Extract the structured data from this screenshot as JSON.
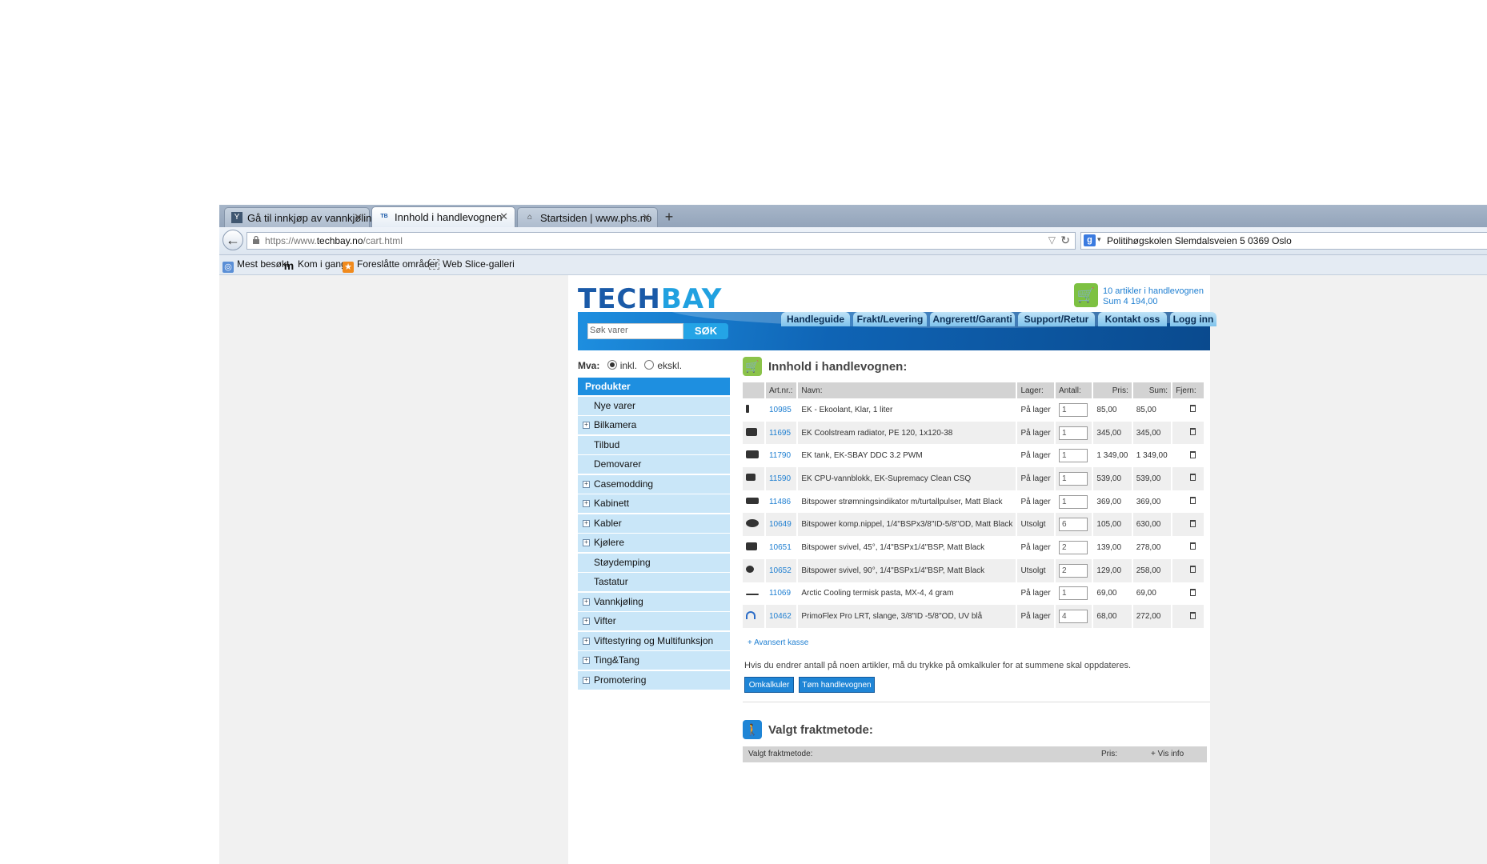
{
  "browser": {
    "tabs": [
      {
        "label": "Gå til innkjøp av vannkjølin...",
        "icon": "y-favicon",
        "active": false
      },
      {
        "label": "Innhold i handlevognen",
        "icon": "techbay-favicon",
        "active": true
      },
      {
        "label": "Startsiden | www.phs.no",
        "icon": "phs-favicon",
        "active": false
      }
    ],
    "new_tab_label": "+",
    "url_prefix": "https://www.",
    "url_domain": "techbay.no",
    "url_path": "/cart.html",
    "search_text": "Politihøgskolen Slemdalsveien 5 0369 Oslo",
    "search_engine_label": "g",
    "bookmarks": [
      {
        "label": "Mest besøkt",
        "icon": "most-visited-icon"
      },
      {
        "label": "Kom i gang",
        "icon": "m-icon"
      },
      {
        "label": "Foreslåtte områder",
        "icon": "suggested-sites-icon"
      },
      {
        "label": "Web Slice-galleri",
        "icon": "web-slice-icon"
      }
    ]
  },
  "site": {
    "logo_part1": "TECH",
    "logo_part2": "BAY",
    "cart_count": "10 artikler i handlevognen",
    "cart_sum": "Sum 4 194,00",
    "search_placeholder": "Søk varer",
    "search_button": "SØK",
    "nav_tabs": [
      "Handleguide",
      "Frakt/Levering",
      "Angrerett/Garanti",
      "Support/Retur",
      "Kontakt oss",
      "Logg inn"
    ],
    "mva_label": "Mva:",
    "mva_incl": "inkl.",
    "mva_excl": "ekskl.",
    "sidebar_head": "Produkter",
    "sidebar_items": [
      {
        "label": "Nye varer",
        "expandable": false
      },
      {
        "label": "Bilkamera",
        "expandable": true
      },
      {
        "label": "Tilbud",
        "expandable": false
      },
      {
        "label": "Demovarer",
        "expandable": false
      },
      {
        "label": "Casemodding",
        "expandable": true
      },
      {
        "label": "Kabinett",
        "expandable": true
      },
      {
        "label": "Kabler",
        "expandable": true
      },
      {
        "label": "Kjølere",
        "expandable": true
      },
      {
        "label": "Støydemping",
        "expandable": false
      },
      {
        "label": "Tastatur",
        "expandable": false
      },
      {
        "label": "Vannkjøling",
        "expandable": true
      },
      {
        "label": "Vifter",
        "expandable": true
      },
      {
        "label": "Viftestyring og Multifunksjon",
        "expandable": true
      },
      {
        "label": "Ting&Tang",
        "expandable": true
      },
      {
        "label": "Promotering",
        "expandable": true
      }
    ],
    "cart_title": "Innhold i handlevognen:",
    "table_headers": [
      "Art.nr.:",
      "Navn:",
      "Lager:",
      "Antall:",
      "Pris:",
      "Sum:",
      "Fjern:"
    ],
    "cart_items": [
      {
        "art": "10985",
        "name": "EK - Ekoolant, Klar, 1 liter",
        "stock": "På lager",
        "qty": "1",
        "price": "85,00",
        "sum": "85,00"
      },
      {
        "art": "11695",
        "name": "EK Coolstream radiator, PE 120, 1x120-38",
        "stock": "På lager",
        "qty": "1",
        "price": "345,00",
        "sum": "345,00"
      },
      {
        "art": "11790",
        "name": "EK tank, EK-SBAY DDC 3.2 PWM",
        "stock": "På lager",
        "qty": "1",
        "price": "1 349,00",
        "sum": "1 349,00"
      },
      {
        "art": "11590",
        "name": "EK CPU-vannblokk, EK-Supremacy Clean CSQ",
        "stock": "På lager",
        "qty": "1",
        "price": "539,00",
        "sum": "539,00"
      },
      {
        "art": "11486",
        "name": "Bitspower strømningsindikator m/turtallpulser, Matt Black",
        "stock": "På lager",
        "qty": "1",
        "price": "369,00",
        "sum": "369,00"
      },
      {
        "art": "10649",
        "name": "Bitspower komp.nippel, 1/4\"BSPx3/8\"ID-5/8\"OD, Matt Black",
        "stock": "Utsolgt",
        "qty": "6",
        "price": "105,00",
        "sum": "630,00"
      },
      {
        "art": "10651",
        "name": "Bitspower svivel, 45°, 1/4\"BSPx1/4\"BSP, Matt Black",
        "stock": "På lager",
        "qty": "2",
        "price": "139,00",
        "sum": "278,00"
      },
      {
        "art": "10652",
        "name": "Bitspower svivel, 90°, 1/4\"BSPx1/4\"BSP, Matt Black",
        "stock": "Utsolgt",
        "qty": "2",
        "price": "129,00",
        "sum": "258,00"
      },
      {
        "art": "11069",
        "name": "Arctic Cooling termisk pasta, MX-4, 4 gram",
        "stock": "På lager",
        "qty": "1",
        "price": "69,00",
        "sum": "69,00"
      },
      {
        "art": "10462",
        "name": "PrimoFlex Pro LRT, slange, 3/8\"ID -5/8\"OD, UV blå",
        "stock": "På lager",
        "qty": "4",
        "price": "68,00",
        "sum": "272,00"
      }
    ],
    "advanced_checkout": "+ Avansert kasse",
    "notice": "Hvis du endrer antall på noen artikler, må du trykke på omkalkuler for at summene skal oppdateres.",
    "recalc_button": "Omkalkuler",
    "empty_button": "Tøm handlevognen",
    "shipping_title": "Valgt fraktmetode:",
    "shipping_headers": {
      "method": "Valgt fraktmetode:",
      "price": "Pris:",
      "info": "+ Vis info"
    }
  },
  "colors": {
    "brand_blue": "#1e8fe0",
    "link_blue": "#1f7fd1",
    "nav_light": "#c9e6f8",
    "cart_green": "#8bc34a"
  }
}
